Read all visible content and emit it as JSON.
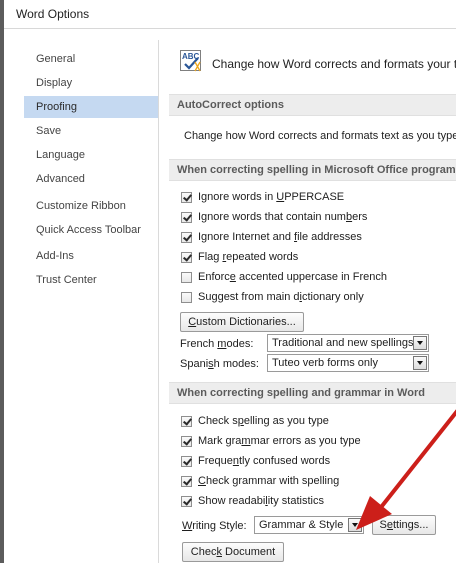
{
  "window": {
    "title": "Word Options"
  },
  "nav": {
    "items": [
      {
        "label": "General"
      },
      {
        "label": "Display"
      },
      {
        "label": "Proofing"
      },
      {
        "label": "Save"
      },
      {
        "label": "Language"
      },
      {
        "label": "Advanced"
      },
      {
        "label": "Customize Ribbon"
      },
      {
        "label": "Quick Access Toolbar"
      },
      {
        "label": "Add-Ins"
      },
      {
        "label": "Trust Center"
      }
    ],
    "active": "Proofing"
  },
  "header": {
    "icon": "abc-spell-check-icon",
    "text": "Change how Word corrects and formats your t"
  },
  "autocorrect": {
    "section_title": "AutoCorrect options",
    "description": "Change how Word corrects and formats text as you type:"
  },
  "office_spelling": {
    "section_title": "When correcting spelling in Microsoft Office programs",
    "checkboxes": [
      {
        "pre": "Ignore words in ",
        "key": "U",
        "post": "PPERCASE",
        "checked": true
      },
      {
        "pre": "Ignore words that contain num",
        "key": "b",
        "post": "ers",
        "checked": true
      },
      {
        "pre": "Ignore Internet and ",
        "key": "f",
        "post": "ile addresses",
        "checked": true
      },
      {
        "pre": "Flag ",
        "key": "r",
        "post": "epeated words",
        "checked": true
      },
      {
        "pre": "Enforc",
        "key": "e",
        "post": " accented uppercase in French",
        "checked": false
      },
      {
        "pre": "Suggest from main d",
        "key": "i",
        "post": "ctionary only",
        "checked": false
      }
    ],
    "custom_dictionaries_button": {
      "pre": "",
      "key": "C",
      "post": "ustom Dictionaries..."
    },
    "french_modes": {
      "label_pre": "French ",
      "label_key": "m",
      "label_post": "odes:",
      "value": "Traditional and new spellings"
    },
    "spanish_modes": {
      "label_pre": "Spani",
      "label_key": "s",
      "label_post": "h modes:",
      "value": "Tuteo verb forms only"
    }
  },
  "word_spelling": {
    "section_title": "When correcting spelling and grammar in Word",
    "checkboxes": [
      {
        "pre": "Check s",
        "key": "p",
        "post": "elling as you type",
        "checked": true
      },
      {
        "pre": "Mark gra",
        "key": "m",
        "post": "mar errors as you type",
        "checked": true
      },
      {
        "pre": "Freque",
        "key": "n",
        "post": "tly confused words",
        "checked": true
      },
      {
        "pre": "",
        "key": "C",
        "post": "heck grammar with spelling",
        "checked": true
      },
      {
        "pre": "Show readabi",
        "key": "l",
        "post": "ity statistics",
        "checked": true
      }
    ],
    "writing_style": {
      "label_pre": "",
      "label_key": "W",
      "label_post": "riting Style:",
      "value": "Grammar & Style"
    },
    "settings_button": {
      "pre": "S",
      "key": "e",
      "post": "ttings..."
    },
    "check_document_button": {
      "pre": "Chec",
      "key": "k",
      "post": " Document"
    }
  },
  "annotation": {
    "arrow_color": "#cc1f1a"
  },
  "colors": {
    "active_nav": "#c5d9f1",
    "section_bar": "#ededed"
  }
}
